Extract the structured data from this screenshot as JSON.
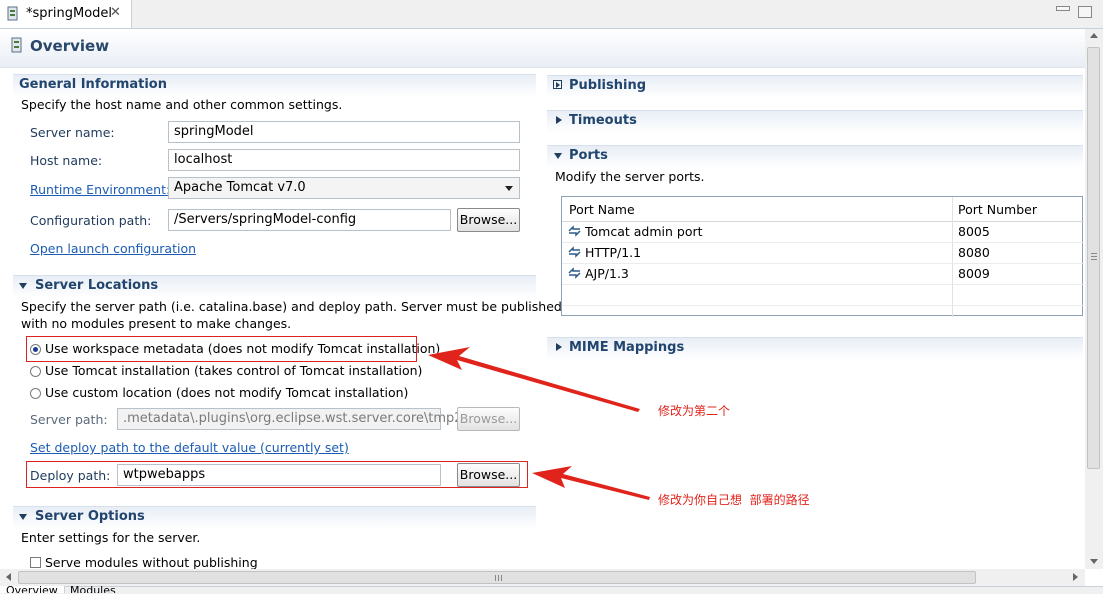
{
  "tab": {
    "title": "*springModel",
    "close": "✕"
  },
  "header": {
    "title": "Overview"
  },
  "general": {
    "title": "General Information",
    "description": "Specify the host name and other common settings.",
    "server_name_label": "Server name:",
    "server_name_value": "springModel",
    "host_name_label": "Host name:",
    "host_name_value": "localhost",
    "runtime_label": "Runtime Environment:",
    "runtime_value": "Apache Tomcat v7.0",
    "config_path_label": "Configuration path:",
    "config_path_value": "/Servers/springModel-config",
    "browse_label": "Browse...",
    "open_launch_link": "Open launch configuration"
  },
  "locations": {
    "title": "Server Locations",
    "description_line1": "Specify the server path (i.e. catalina.base) and deploy path. Server must be published",
    "description_line2": "with no modules present to make changes.",
    "radio_workspace": "Use workspace metadata (does not modify Tomcat installation)",
    "radio_tomcat": "Use Tomcat installation (takes control of Tomcat installation)",
    "radio_custom": "Use custom location (does not modify Tomcat installation)",
    "server_path_label": "Server path:",
    "server_path_value": ".metadata\\.plugins\\org.eclipse.wst.server.core\\tmp2",
    "browse_label": "Browse...",
    "set_deploy_link": "Set deploy path to the default value (currently set)",
    "deploy_path_label": "Deploy path:",
    "deploy_path_value": "wtpwebapps",
    "deploy_browse_label": "Browse..."
  },
  "options": {
    "title": "Server Options",
    "description": "Enter settings for the server.",
    "serve_modules": "Serve modules without publishing"
  },
  "right": {
    "publishing": "Publishing",
    "timeouts": "Timeouts",
    "ports_title": "Ports",
    "ports_description": "Modify the server ports.",
    "ports_col_name": "Port Name",
    "ports_col_number": "Port Number",
    "ports": [
      {
        "name": "Tomcat admin port",
        "number": "8005"
      },
      {
        "name": "HTTP/1.1",
        "number": "8080"
      },
      {
        "name": "AJP/1.3",
        "number": "8009"
      }
    ],
    "mime": "MIME Mappings"
  },
  "annotations": {
    "first": "修改为第二个",
    "second": "修改为你自己想  部署的路径"
  },
  "colors": {
    "section_title": "#22456e",
    "annotation_red": "#e0241b",
    "link": "#1c5cb3"
  },
  "bottom_tabs": [
    "Overview",
    "Modules"
  ]
}
